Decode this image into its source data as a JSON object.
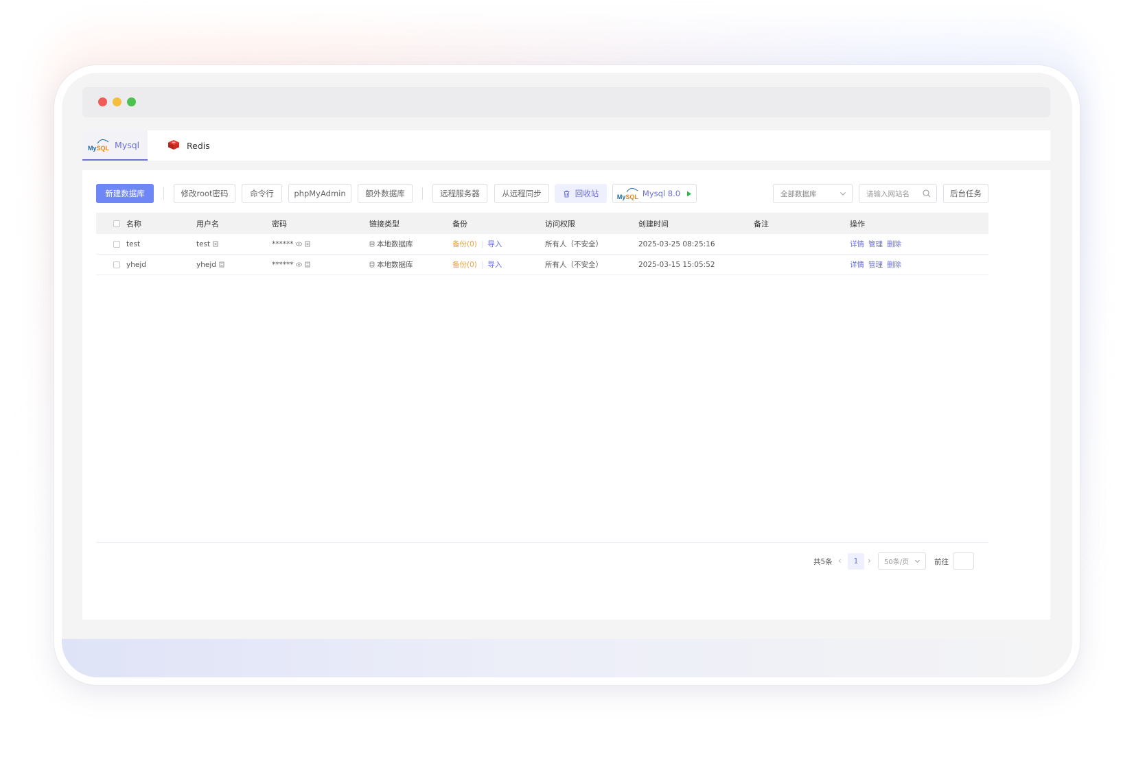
{
  "tabs": [
    {
      "label": "Mysql",
      "icon": "mysql-logo",
      "active": true
    },
    {
      "label": "Redis",
      "icon": "redis-icon",
      "active": false
    }
  ],
  "mysql_logo": {
    "my": "My",
    "sql": "SQL"
  },
  "toolbar": {
    "new_db": "新建数据库",
    "change_root_pw": "修改root密码",
    "cli": "命令行",
    "phpmyadmin": "phpMyAdmin",
    "extra_db": "额外数据库",
    "remote_server": "远程服务器",
    "sync_from_remote": "从远程同步",
    "recycle_bin": "回收站",
    "mysql_version": "Mysql 8.0",
    "filter_select": "全部数据库",
    "search_placeholder": "请输入网站名",
    "background_tasks": "后台任务"
  },
  "table": {
    "headers": {
      "name": "名称",
      "username": "用户名",
      "password": "密码",
      "link_type": "链接类型",
      "backup": "备份",
      "access": "访问权限",
      "created": "创建时间",
      "remark": "备注",
      "actions": "操作"
    },
    "rows": [
      {
        "name": "test",
        "username": "test",
        "password": "******",
        "link_type": "本地数据库",
        "backup": "备份(0)",
        "import": "导入",
        "access": "所有人（不安全）",
        "created": "2025-03-25 08:25:16",
        "remark": "",
        "actions": [
          "详情",
          "管理",
          "删除"
        ]
      },
      {
        "name": "yhejd",
        "username": "yhejd",
        "password": "******",
        "link_type": "本地数据库",
        "backup": "备份(0)",
        "import": "导入",
        "access": "所有人（不安全）",
        "created": "2025-03-15 15:05:52",
        "remark": "",
        "actions": [
          "详情",
          "管理",
          "删除"
        ]
      }
    ]
  },
  "pagination": {
    "total": "共5条",
    "current_page": "1",
    "page_size": "50条/页",
    "goto_label": "前往",
    "prev_icon": "‹",
    "next_icon": "›"
  },
  "colors": {
    "primary": "#6f86f6",
    "accent": "#6b6fd8",
    "warning": "#e6a23c",
    "mac_red": "#f05b57",
    "mac_yellow": "#f5be3c",
    "mac_green": "#4fc052"
  }
}
